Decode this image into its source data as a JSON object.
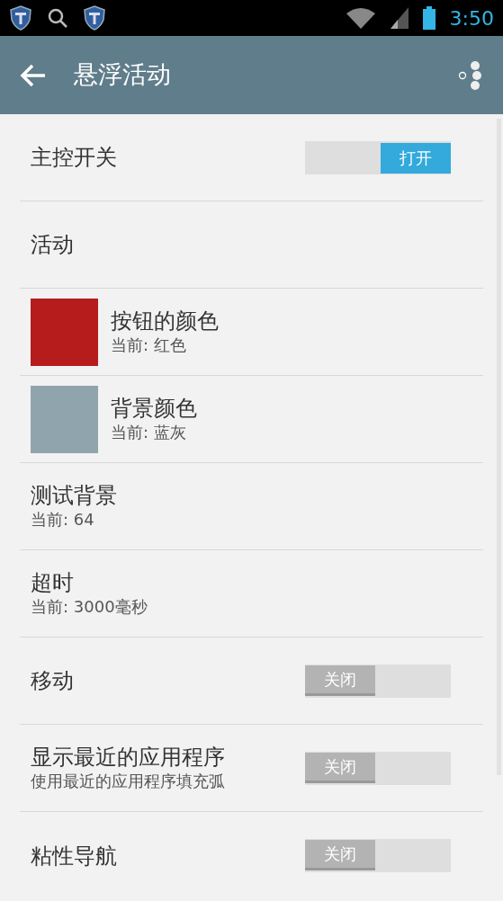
{
  "status_bar": {
    "time": "3:50"
  },
  "toolbar": {
    "title": "悬浮活动"
  },
  "settings": [
    {
      "kind": "toggle",
      "title": "主控开关",
      "toggle": {
        "on": true,
        "label": "打开"
      }
    },
    {
      "kind": "header",
      "title": "活动"
    },
    {
      "kind": "color",
      "title": "按钮的颜色",
      "summary": "当前: 红色",
      "color": "#b71c1c"
    },
    {
      "kind": "color",
      "title": "背景颜色",
      "summary": "当前: 蓝灰",
      "color": "#90a4ae"
    },
    {
      "kind": "text",
      "title": "测试背景",
      "summary": "当前: 64"
    },
    {
      "kind": "text",
      "title": "超时",
      "summary": "当前: 3000毫秒"
    },
    {
      "kind": "toggle",
      "title": "移动",
      "toggle": {
        "on": false,
        "label": "关闭"
      }
    },
    {
      "kind": "toggle",
      "title": "显示最近的应用程序",
      "summary": "使用最近的应用程序填充弧",
      "toggle": {
        "on": false,
        "label": "关闭"
      }
    },
    {
      "kind": "toggle",
      "title": "粘性导航",
      "toggle": {
        "on": false,
        "label": "关闭"
      }
    }
  ]
}
